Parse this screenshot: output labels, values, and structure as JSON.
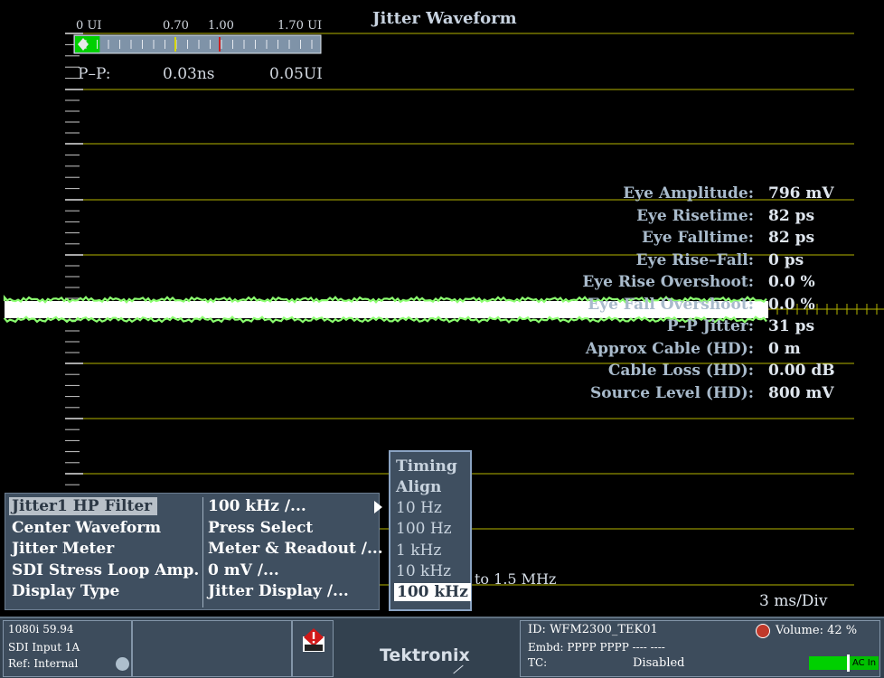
{
  "window": {
    "title": "Jitter Waveform"
  },
  "meter": {
    "scale_labels": [
      "0 UI",
      "0.70",
      "1.00",
      "1.70 UI"
    ],
    "pp_label": "P–P:",
    "pp_ns": "0.03ns",
    "pp_ui": "0.05UI",
    "level_fraction": 0.03,
    "colors": {
      "fill": "#00d000",
      "bar": "#7f93a8",
      "yellow_mark": "#d6d600",
      "red_mark": "#cc2020"
    }
  },
  "readouts": [
    {
      "label": "Eye Amplitude:",
      "value": "796 mV"
    },
    {
      "label": "Eye Risetime:",
      "value": "82 ps"
    },
    {
      "label": "Eye Falltime:",
      "value": "82 ps"
    },
    {
      "label": "Eye Rise–Fall:",
      "value": "0 ps"
    },
    {
      "label": "Eye Rise Overshoot:",
      "value": "0.0 %"
    },
    {
      "label": "Eye Fall Overshoot:",
      "value": "0.0 %"
    },
    {
      "label": "P–P Jitter:",
      "value": "31 ps"
    },
    {
      "label": "Approx Cable (HD):",
      "value": "0 m"
    },
    {
      "label": "Cable Loss (HD):",
      "value": "0.00 dB"
    },
    {
      "label": "Source Level (HD):",
      "value": "800 mV"
    }
  ],
  "menu": {
    "items": [
      {
        "label": "Jitter1 HP Filter",
        "value": "100 kHz /..."
      },
      {
        "label": "Center Waveform",
        "value": "Press Select"
      },
      {
        "label": "Jitter Meter",
        "value": "Meter & Readout /..."
      },
      {
        "label": "SDI Stress Loop Amp.",
        "value": "0 mV  /..."
      },
      {
        "label": "Display Type",
        "value": "Jitter Display /..."
      }
    ],
    "selected_index": 0
  },
  "submenu": {
    "headers": [
      "Timing",
      "Align"
    ],
    "options": [
      "10 Hz",
      "100 Hz",
      "1 kHz",
      "10 kHz",
      "100 kHz"
    ],
    "selected": "100 kHz"
  },
  "freq_note": "to 1.5 MHz",
  "timebase": "3 ms/Div",
  "status": {
    "format": "1080i 59.94",
    "input": "SDI Input 1A",
    "ref": "Ref: Internal",
    "brand": "Tektronix",
    "id": "ID: WFM2300_TEK01",
    "embd": "Embd: PPPP PPPP ---- ----",
    "tc_label": "TC:",
    "tc_value": "Disabled",
    "volume": "Volume:  42 %",
    "ac_label": "AC In"
  },
  "colors": {
    "graticule": "#b4b400",
    "trace": "#8cff70",
    "menu_bg": "#3f4f60",
    "status_bg": "#33414f"
  }
}
